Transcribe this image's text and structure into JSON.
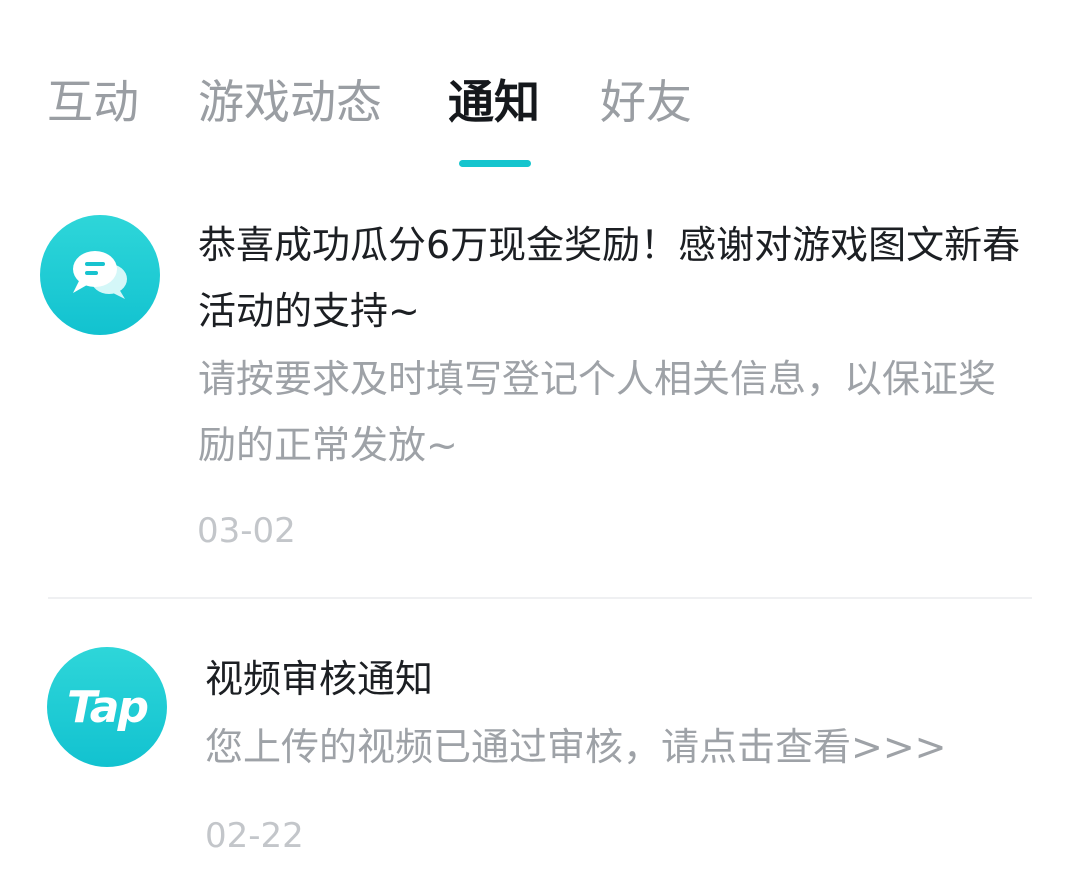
{
  "tabs": [
    {
      "label": "互动",
      "active": false
    },
    {
      "label": "游戏动态",
      "active": false
    },
    {
      "label": "通知",
      "active": true
    },
    {
      "label": "好友",
      "active": false
    }
  ],
  "accent_color": "#15c5ce",
  "notices": [
    {
      "icon": "chat-bubble-icon",
      "title": "恭喜成功瓜分6万现金奖励！感谢对游戏图文新春活动的支持~",
      "body": "请按要求及时填写登记个人相关信息，以保证奖励的正常发放~",
      "date": "03-02"
    },
    {
      "icon": "tap-logo-icon",
      "logo_text": "Tap",
      "title": "视频审核通知",
      "body": "您上传的视频已通过审核，请点击查看>>>",
      "date": "02-22"
    }
  ]
}
